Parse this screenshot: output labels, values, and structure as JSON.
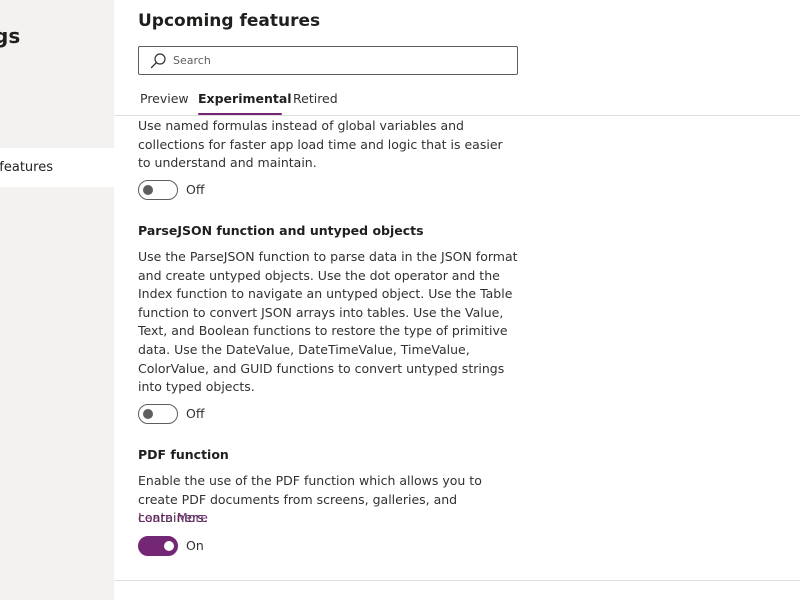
{
  "sidebar": {
    "title": "gs",
    "items": [
      {
        "label": "g features",
        "selected": true
      }
    ]
  },
  "main": {
    "title": "Upcoming features",
    "search": {
      "placeholder": "Search",
      "value": "",
      "icon": "search-icon"
    },
    "tabs": [
      {
        "label": "Preview",
        "selected": false
      },
      {
        "label": "Experimental",
        "selected": true
      },
      {
        "label": "Retired",
        "selected": false
      }
    ],
    "features": [
      {
        "title": "",
        "description": "Use named formulas instead of global variables and collections for faster app load time and logic that is easier to understand and maintain.",
        "toggle": {
          "on": false,
          "label": "Off"
        }
      },
      {
        "title": "ParseJSON function and untyped objects",
        "description": "Use the ParseJSON function to parse data in the JSON format and create untyped objects. Use the dot operator and the Index function to navigate an untyped object. Use the Table function to convert JSON arrays into tables. Use the Value, Text, and Boolean functions to restore the type of primitive data. Use the DateValue, DateTimeValue, TimeValue, ColorValue, and GUID functions to convert untyped strings into typed objects.",
        "toggle": {
          "on": false,
          "label": "Off"
        }
      },
      {
        "title": "PDF function",
        "description": "Enable the use of the PDF function which allows you to create PDF documents from screens, galleries, and containers.",
        "link": "Learn More",
        "toggle": {
          "on": true,
          "label": "On"
        }
      }
    ]
  },
  "colors": {
    "accent": "#742774",
    "text": "#323130",
    "sidebar_bg": "#f3f2f1",
    "divider": "#e1dfdd"
  }
}
